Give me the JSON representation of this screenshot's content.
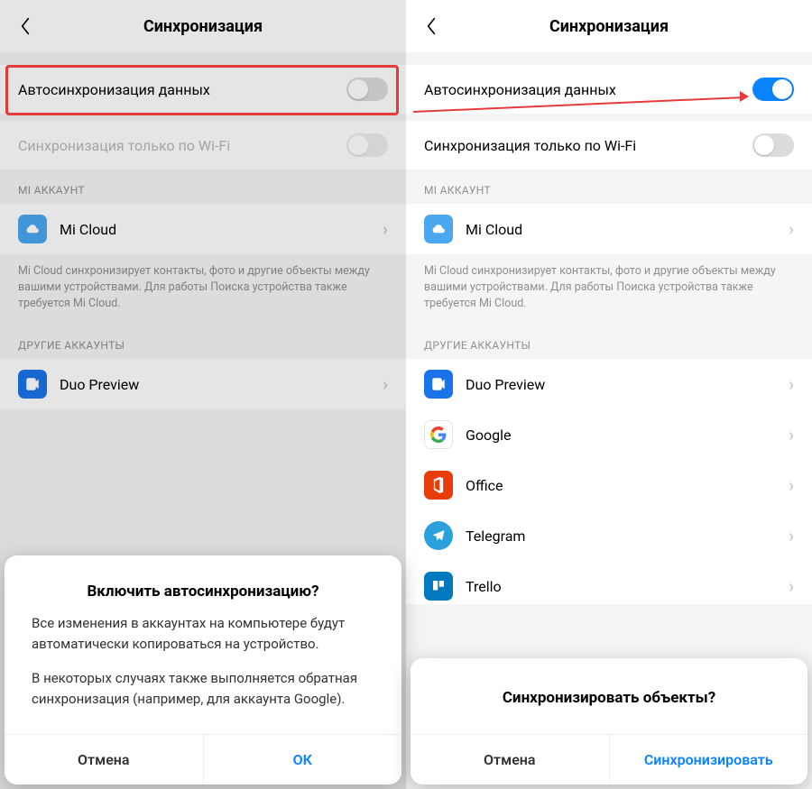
{
  "left": {
    "title": "Синхронизация",
    "autosync_label": "Автосинхронизация данных",
    "wifi_label": "Синхронизация только по Wi-Fi",
    "section1": "MI АККАУНТ",
    "mi_cloud": "Mi Cloud",
    "mi_cloud_desc": "Mi Cloud синхронизирует контакты, фото и другие объекты между вашими устройствами. Для работы Поиска устройства также требуется Mi Cloud.",
    "section2": "ДРУГИЕ АККАУНТЫ",
    "duo": "Duo Preview",
    "dialog": {
      "title": "Включить автосинхронизацию?",
      "p1": "Все изменения в аккаунтах на компьютере будут автоматически копироваться на устройство.",
      "p2": "В некоторых случаях также выполняется обратная синхронизация (например, для аккаунта Google).",
      "cancel": "Отмена",
      "ok": "ОК"
    }
  },
  "right": {
    "title": "Синхронизация",
    "autosync_label": "Автосинхронизация данных",
    "wifi_label": "Синхронизация только по Wi-Fi",
    "section1": "MI АККАУНТ",
    "mi_cloud": "Mi Cloud",
    "mi_cloud_desc": "Mi Cloud синхронизирует контакты, фото и другие объекты между вашими устройствами. Для работы Поиска устройства также требуется Mi Cloud.",
    "section2": "ДРУГИЕ АККАУНТЫ",
    "items": {
      "duo": "Duo Preview",
      "google": "Google",
      "office": "Office",
      "telegram": "Telegram",
      "trello": "Trello"
    },
    "dialog": {
      "title": "Синхронизировать объекты?",
      "cancel": "Отмена",
      "ok": "Синхронизировать"
    }
  }
}
